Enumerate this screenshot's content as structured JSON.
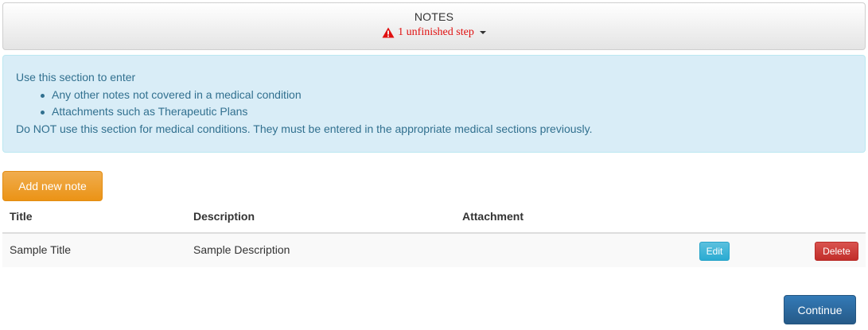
{
  "header": {
    "title": "NOTES",
    "warning": "1 unfinished step",
    "warning_color": "#e01010",
    "warning_icon": "warning-triangle-icon",
    "dropdown_icon": "caret-down-icon"
  },
  "info": {
    "intro": "Use this section to enter",
    "items": [
      "Any other notes not covered in a medical condition",
      "Attachments such as Therapeutic Plans"
    ],
    "footer": "Do NOT use this section for medical conditions. They must be entered in the appropriate medical sections previously."
  },
  "actions": {
    "add_note_label": "Add new note",
    "continue_label": "Continue"
  },
  "table": {
    "columns": [
      "Title",
      "Description",
      "Attachment"
    ],
    "rows": [
      {
        "title": "Sample Title",
        "description": "Sample Description",
        "attachment": "",
        "edit_label": "Edit",
        "delete_label": "Delete"
      }
    ]
  },
  "colors": {
    "info_bg": "#d9edf7",
    "info_text": "#31708f",
    "add_button": "#f0ad4e",
    "edit_button": "#5bc0de",
    "delete_button": "#d9534f",
    "continue_button": "#337ab7"
  }
}
